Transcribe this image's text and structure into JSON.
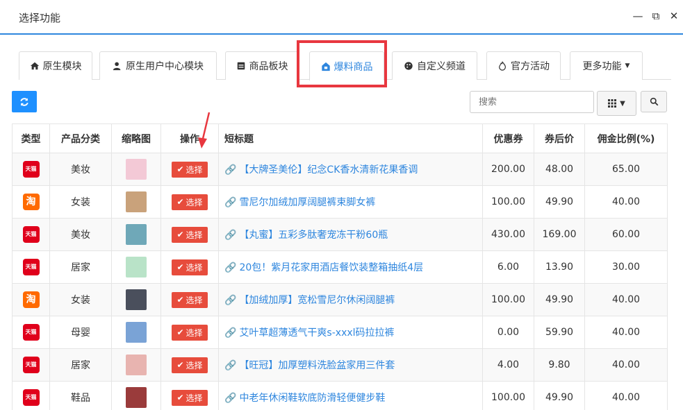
{
  "window": {
    "title": "选择功能"
  },
  "tabs": [
    {
      "label": "原生模块",
      "icon": "home-icon"
    },
    {
      "label": "原生用户中心模块",
      "icon": "user-icon"
    },
    {
      "label": "商品板块",
      "icon": "calendar-icon"
    },
    {
      "label": "爆料商品",
      "icon": "shop-icon",
      "active": true
    },
    {
      "label": "自定义频道",
      "icon": "paint-icon"
    },
    {
      "label": "官方活动",
      "icon": "fire-icon"
    },
    {
      "label": "更多功能",
      "icon": "caret-down-icon"
    }
  ],
  "toolbar": {
    "search_placeholder": "搜索"
  },
  "table": {
    "headers": [
      "类型",
      "产品分类",
      "缩略图",
      "操作",
      "短标题",
      "优惠券",
      "券后价",
      "佣金比例(%)"
    ],
    "select_label": "选择",
    "rows": [
      {
        "platform": "tmall",
        "platform_label": "天猫",
        "category": "美妆",
        "thumb_color": "#f3c9d6",
        "title": "【大牌圣美伦】纪念CK香水清新花果香调",
        "coupon": "200.00",
        "price": "48.00",
        "commission": "65.00"
      },
      {
        "platform": "taobao",
        "platform_label": "淘",
        "category": "女装",
        "thumb_color": "#c9a27b",
        "title": "雪尼尔加绒加厚阔腿裤束脚女裤",
        "coupon": "100.00",
        "price": "49.90",
        "commission": "40.00"
      },
      {
        "platform": "tmall",
        "platform_label": "天猫",
        "category": "美妆",
        "thumb_color": "#6fa8b8",
        "title": "【丸蜜】五彩多肽奢宠冻干粉60瓶",
        "coupon": "430.00",
        "price": "169.00",
        "commission": "60.00"
      },
      {
        "platform": "tmall",
        "platform_label": "天猫",
        "category": "居家",
        "thumb_color": "#b9e3c8",
        "title": "20包！紫月花家用酒店餐饮装整箱抽纸4层",
        "coupon": "6.00",
        "price": "13.90",
        "commission": "30.00"
      },
      {
        "platform": "taobao",
        "platform_label": "淘",
        "category": "女装",
        "thumb_color": "#4a4f5c",
        "title": "【加绒加厚】宽松雪尼尔休闲阔腿裤",
        "coupon": "100.00",
        "price": "49.90",
        "commission": "40.00"
      },
      {
        "platform": "tmall",
        "platform_label": "天猫",
        "category": "母婴",
        "thumb_color": "#7aa3d6",
        "title": "艾叶草超薄透气干爽s-xxxl码拉拉裤",
        "coupon": "0.00",
        "price": "59.90",
        "commission": "40.00"
      },
      {
        "platform": "tmall",
        "platform_label": "天猫",
        "category": "居家",
        "thumb_color": "#e8b4b0",
        "title": "【旺冠】加厚塑料洗脸盆家用三件套",
        "coupon": "4.00",
        "price": "9.80",
        "commission": "40.00"
      },
      {
        "platform": "tmall",
        "platform_label": "天猫",
        "category": "鞋品",
        "thumb_color": "#9a3b3b",
        "title": "中老年休闲鞋软底防滑轻便健步鞋",
        "coupon": "100.00",
        "price": "49.90",
        "commission": "40.00"
      }
    ]
  }
}
